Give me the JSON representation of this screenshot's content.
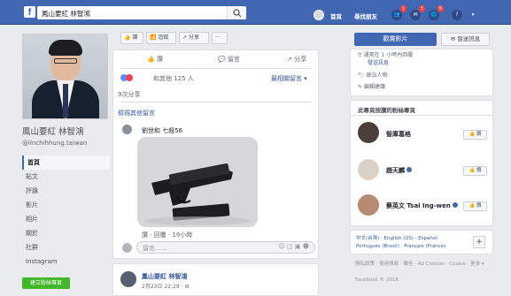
{
  "topbar": {
    "search_value": "鳳山要紅 林智鴻",
    "nav": [
      "首頁",
      "尋找朋友"
    ],
    "badges": {
      "friends": "1",
      "messages": "1",
      "notifications": "6"
    }
  },
  "profile": {
    "name": "鳳山要紅 林智鴻",
    "handle": "@linchihhung.taiwan",
    "nav_items": [
      "首頁",
      "貼文",
      "評論",
      "影片",
      "相片",
      "關於",
      "社群",
      "Instagram"
    ],
    "create_page": "建立粉絲專頁"
  },
  "page_actions": {
    "like": "讚",
    "follow": "追蹤",
    "share": "分享",
    "more": "···"
  },
  "post": {
    "actions": {
      "like": "讚",
      "comment": "留言",
      "share": "分享"
    },
    "reaction_summary": "和其他 125 人",
    "sort": "最相關留言 ▾",
    "shares": "9次分享",
    "view_previous": "檢視其他留言",
    "comment_author": "劉世和 七殺56",
    "comment_meta": "讚 · 回覆 · 19小時",
    "comment_placeholder": "留言……"
  },
  "post2": {
    "author": "鳳山要紅 林智鴻",
    "date": "2月23日 22:29 · ⚙"
  },
  "right": {
    "see_video": "觀賞影片",
    "send_message": "發送訊息",
    "about_lines": [
      "通常在 1 小時內回覆",
      "發送訊息",
      "政治人物",
      "編輯建議"
    ],
    "liked_pages_title": "此專頁按讚的粉絲專頁",
    "liked_pages": [
      {
        "name": "智庫葛格",
        "button": "讚"
      },
      {
        "name": "趙天麟",
        "button": "讚"
      },
      {
        "name": "蔡英文 Tsai Ing-wen",
        "button": "讚"
      }
    ],
    "languages_line1": "中文(台灣) · English (US) · Español",
    "languages_line2": "Português (Brasil) · Français (France)",
    "footer_line1": "隱私政策 · 使用條款 · 廣告 · Ad Choices · Cookie · 更多 ▾",
    "footer_line2": "Facebook © 2018"
  },
  "colors": {
    "brand": "#4267b2",
    "page_bg": "#e9ebee",
    "green": "#42b72a"
  }
}
